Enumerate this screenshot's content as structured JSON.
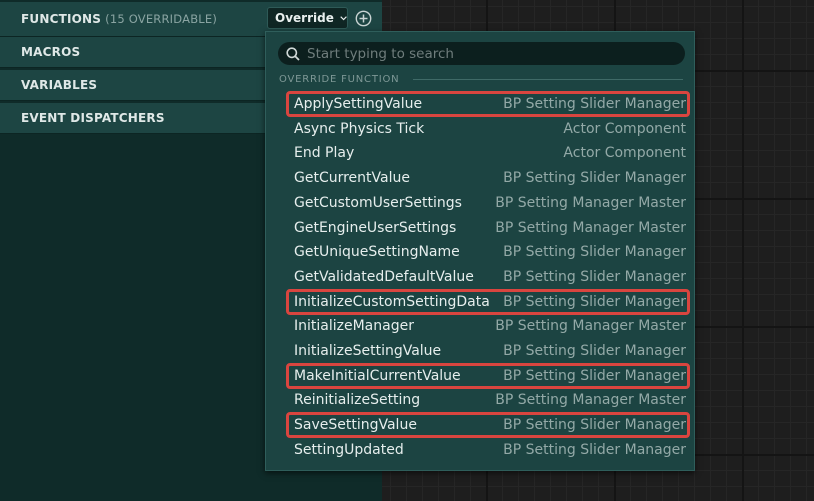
{
  "panel": {
    "sections": [
      {
        "id": "functions",
        "label": "FUNCTIONS",
        "sublabel": "(15 OVERRIDABLE)"
      },
      {
        "id": "macros",
        "label": "MACROS"
      },
      {
        "id": "variables",
        "label": "VARIABLES"
      },
      {
        "id": "event_dispatchers",
        "label": "EVENT DISPATCHERS"
      }
    ],
    "override_button": {
      "label": "Override",
      "icon": "chevron-down-icon"
    },
    "add_button": {
      "icon": "plus-circle-icon"
    }
  },
  "dropdown": {
    "search": {
      "placeholder": "Start typing to search",
      "value": "",
      "icon": "search-icon"
    },
    "category": "OVERRIDE FUNCTION",
    "highlight_color": "#d9453f",
    "items": [
      {
        "name": "ApplySettingValue",
        "owner": "BP Setting Slider Manager",
        "highlighted": true
      },
      {
        "name": "Async Physics Tick",
        "owner": "Actor Component",
        "highlighted": false
      },
      {
        "name": "End Play",
        "owner": "Actor Component",
        "highlighted": false
      },
      {
        "name": "GetCurrentValue",
        "owner": "BP Setting Slider Manager",
        "highlighted": false
      },
      {
        "name": "GetCustomUserSettings",
        "owner": "BP Setting Manager Master",
        "highlighted": false
      },
      {
        "name": "GetEngineUserSettings",
        "owner": "BP Setting Manager Master",
        "highlighted": false
      },
      {
        "name": "GetUniqueSettingName",
        "owner": "BP Setting Slider Manager",
        "highlighted": false
      },
      {
        "name": "GetValidatedDefaultValue",
        "owner": "BP Setting Slider Manager",
        "highlighted": false
      },
      {
        "name": "InitializeCustomSettingData",
        "owner": "BP Setting Slider Manager",
        "highlighted": true
      },
      {
        "name": "InitializeManager",
        "owner": "BP Setting Manager Master",
        "highlighted": false
      },
      {
        "name": "InitializeSettingValue",
        "owner": "BP Setting Slider Manager",
        "highlighted": false
      },
      {
        "name": "MakeInitialCurrentValue",
        "owner": "BP Setting Slider Manager",
        "highlighted": true
      },
      {
        "name": "ReinitializeSetting",
        "owner": "BP Setting Manager Master",
        "highlighted": false
      },
      {
        "name": "SaveSettingValue",
        "owner": "BP Setting Slider Manager",
        "highlighted": true
      },
      {
        "name": "SettingUpdated",
        "owner": "BP Setting Slider Manager",
        "highlighted": false
      }
    ]
  }
}
